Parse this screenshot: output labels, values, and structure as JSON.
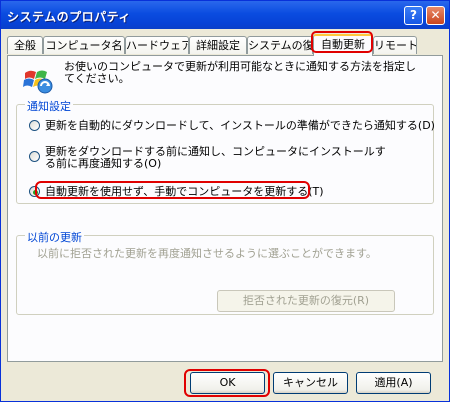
{
  "window": {
    "title": "システムのプロパティ",
    "help_glyph": "?",
    "close_glyph": "✕"
  },
  "tabs": [
    "全般",
    "コンピュータ名",
    "ハードウェア",
    "詳細設定",
    "システムの復元",
    "自動更新",
    "リモート"
  ],
  "active_tab": "自動更新",
  "intro_text": "お使いのコンピュータで更新が利用可能なときに通知する方法を指定してください。",
  "notify": {
    "group_label": "通知設定",
    "options": [
      {
        "label": "更新を自動的にダウンロードして、インストールの準備ができたら通知する(D)",
        "selected": false
      },
      {
        "label": "更新をダウンロードする前に通知し、コンピュータにインストールする前に再度通知する(O)",
        "selected": false
      },
      {
        "label": "自動更新を使用せず、手動でコンピュータを更新する(T)",
        "selected": true
      }
    ]
  },
  "previous": {
    "group_label": "以前の更新",
    "description": "以前に拒否された更新を再度通知させるように選ぶことができます。",
    "restore_button": "拒否された更新の復元(R)"
  },
  "buttons": {
    "ok": "OK",
    "cancel": "キャンセル",
    "apply": "適用(A)"
  },
  "colors": {
    "titlebar": "#0a4ce0",
    "highlight": "#e00000",
    "group_label": "#0046d5",
    "radio_dot": "#21a121"
  },
  "icons": {
    "window_update": "windows-update-icon"
  }
}
